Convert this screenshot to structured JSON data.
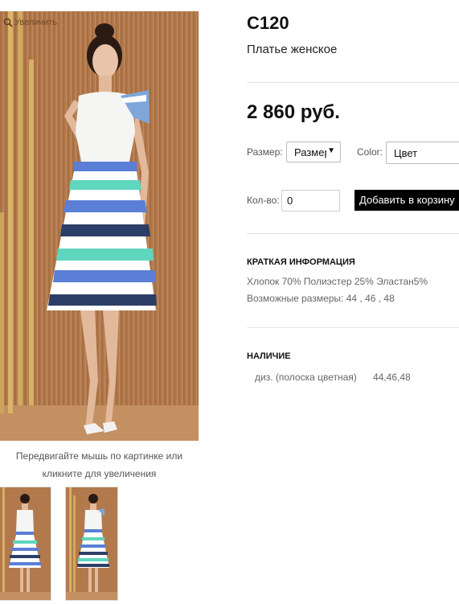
{
  "gallery": {
    "zoom_hint": "Увеличить",
    "caption_line1": "Передвигайте мышь по картинке или",
    "caption_line2": "кликните для увеличения",
    "thumbnails": [
      "thumbnail-back-view",
      "thumbnail-front-view"
    ]
  },
  "product": {
    "sku": "C120",
    "subtitle": "Платье женское",
    "price": "2 860 руб."
  },
  "options": {
    "size_label": "Размер:",
    "size_value": "Размер",
    "color_label": "Color:",
    "color_value": "Цвет",
    "qty_label": "Кол-во:",
    "qty_value": "0",
    "add_to_cart": "Добавить в корзину"
  },
  "short_info": {
    "title": "КРАТКАЯ ИНФОРМАЦИЯ",
    "composition": "Хлопок 70% Полиэстер 25% Эластан5%",
    "sizes": "Возможные размеры: 44 , 46 , 48"
  },
  "availability": {
    "title": "НАЛИЧИЕ",
    "rows": [
      {
        "name": "диз. (полоска цветная)",
        "sizes": "44,46,48"
      }
    ]
  },
  "colors": {
    "wood": "#b0784a",
    "stripe_blue": "#5b7fd6",
    "stripe_navy": "#2d3e66",
    "stripe_mint": "#5fd6be",
    "button_bg": "#000000"
  }
}
